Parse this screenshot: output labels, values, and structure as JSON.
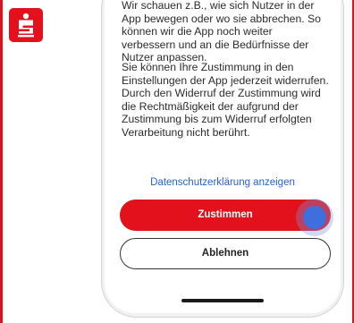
{
  "app": {
    "logo_icon": "sparkasse-logo-icon",
    "brand_color": "#e3111b"
  },
  "consent": {
    "paragraph1": "Wir schauen z.B., wie sich Nutzer in der App bewegen oder wo sie abbrechen. So können wir die App noch weiter verbessern und an die Bedürfnisse der Nutzer anpassen.",
    "paragraph2": "Sie können Ihre Zustimmung in den Einstellungen der App jederzeit widerrufen. Durch den Widerruf der Zustimmung wird die Rechtmäßigkeit der aufgrund der Zustimmung bis zum Widerruf erfolgten Verarbeitung nicht berührt.",
    "privacy_link": "Datenschutzerklärung anzeigen",
    "accept_label": "Zustimmen",
    "decline_label": "Ablehnen"
  },
  "colors": {
    "accent": "#e3111b",
    "link": "#2a62c8",
    "touch_indicator": "#3f6fdc"
  }
}
